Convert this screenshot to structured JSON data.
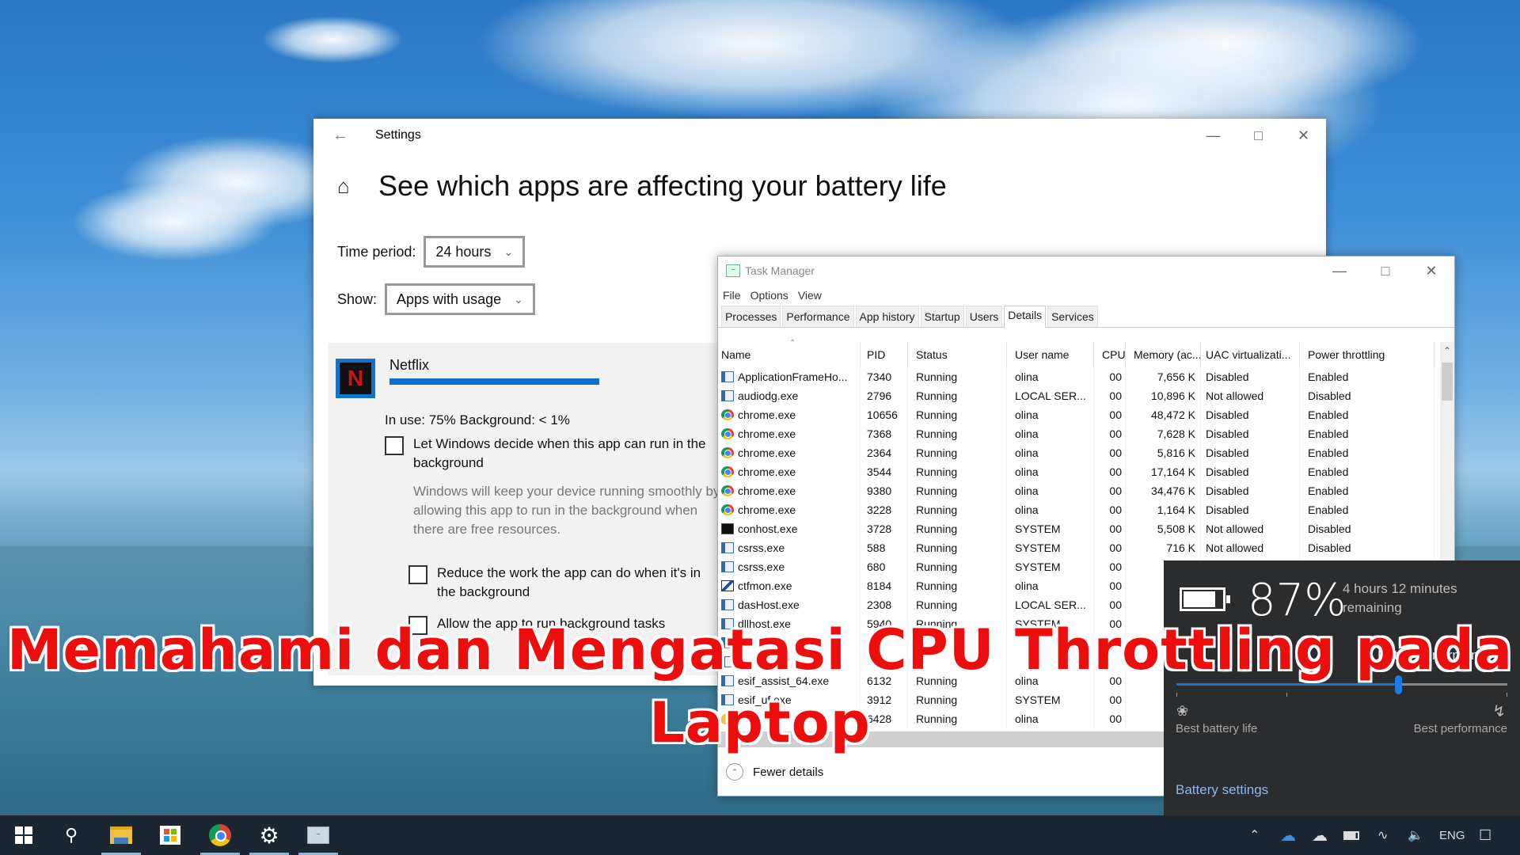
{
  "settings": {
    "window_title": "Settings",
    "heading": "See which apps are affecting your battery life",
    "time_period_label": "Time period:",
    "time_period_value": "24 hours",
    "show_label": "Show:",
    "show_value": "Apps with usage",
    "app": {
      "name": "Netflix",
      "icon_letter": "N",
      "usage_bar_fraction": 0.75,
      "usage_text": "In use: 75% Background: < 1%",
      "option1_label": "Let Windows decide when this app can run in the background",
      "option1_checked": false,
      "option1_desc": "Windows will keep your device running smoothly by allowing this app to run in the background when there are free resources.",
      "option2_label": "Reduce the work the app can do when it's in the background",
      "option2_checked": false,
      "option3_label": "Allow the app to run background tasks",
      "option3_checked": false
    }
  },
  "task_manager": {
    "window_title": "Task Manager",
    "menu": [
      "File",
      "Options",
      "View"
    ],
    "tabs": [
      "Processes",
      "Performance",
      "App history",
      "Startup",
      "Users",
      "Details",
      "Services"
    ],
    "active_tab": "Details",
    "columns": [
      "Name",
      "PID",
      "Status",
      "User name",
      "CPU",
      "Memory (ac...",
      "UAC virtualizati...",
      "Power throttling"
    ],
    "rows": [
      {
        "icon": "win32",
        "name": "ApplicationFrameHo...",
        "pid": "7340",
        "status": "Running",
        "user": "olina",
        "cpu": "00",
        "mem": "7,656 K",
        "uac": "Disabled",
        "pt": "Enabled"
      },
      {
        "icon": "win32",
        "name": "audiodg.exe",
        "pid": "2796",
        "status": "Running",
        "user": "LOCAL SER...",
        "cpu": "00",
        "mem": "10,896 K",
        "uac": "Not allowed",
        "pt": "Disabled"
      },
      {
        "icon": "chrome",
        "name": "chrome.exe",
        "pid": "10656",
        "status": "Running",
        "user": "olina",
        "cpu": "00",
        "mem": "48,472 K",
        "uac": "Disabled",
        "pt": "Enabled"
      },
      {
        "icon": "chrome",
        "name": "chrome.exe",
        "pid": "7368",
        "status": "Running",
        "user": "olina",
        "cpu": "00",
        "mem": "7,628 K",
        "uac": "Disabled",
        "pt": "Enabled"
      },
      {
        "icon": "chrome",
        "name": "chrome.exe",
        "pid": "2364",
        "status": "Running",
        "user": "olina",
        "cpu": "00",
        "mem": "5,816 K",
        "uac": "Disabled",
        "pt": "Enabled"
      },
      {
        "icon": "chrome",
        "name": "chrome.exe",
        "pid": "3544",
        "status": "Running",
        "user": "olina",
        "cpu": "00",
        "mem": "17,164 K",
        "uac": "Disabled",
        "pt": "Enabled"
      },
      {
        "icon": "chrome",
        "name": "chrome.exe",
        "pid": "9380",
        "status": "Running",
        "user": "olina",
        "cpu": "00",
        "mem": "34,476 K",
        "uac": "Disabled",
        "pt": "Enabled"
      },
      {
        "icon": "chrome",
        "name": "chrome.exe",
        "pid": "3228",
        "status": "Running",
        "user": "olina",
        "cpu": "00",
        "mem": "1,164 K",
        "uac": "Disabled",
        "pt": "Enabled"
      },
      {
        "icon": "console",
        "name": "conhost.exe",
        "pid": "3728",
        "status": "Running",
        "user": "SYSTEM",
        "cpu": "00",
        "mem": "5,508 K",
        "uac": "Not allowed",
        "pt": "Disabled"
      },
      {
        "icon": "win32",
        "name": "csrss.exe",
        "pid": "588",
        "status": "Running",
        "user": "SYSTEM",
        "cpu": "00",
        "mem": "716 K",
        "uac": "Not allowed",
        "pt": "Disabled"
      },
      {
        "icon": "win32",
        "name": "csrss.exe",
        "pid": "680",
        "status": "Running",
        "user": "SYSTEM",
        "cpu": "00",
        "mem": "",
        "uac": "",
        "pt": ""
      },
      {
        "icon": "ctf",
        "name": "ctfmon.exe",
        "pid": "8184",
        "status": "Running",
        "user": "olina",
        "cpu": "00",
        "mem": "",
        "uac": "",
        "pt": ""
      },
      {
        "icon": "win32",
        "name": "dasHost.exe",
        "pid": "2308",
        "status": "Running",
        "user": "LOCAL SER...",
        "cpu": "00",
        "mem": "",
        "uac": "",
        "pt": ""
      },
      {
        "icon": "win32",
        "name": "dllhost.exe",
        "pid": "5940",
        "status": "Running",
        "user": "SYSTEM",
        "cpu": "00",
        "mem": "",
        "uac": "",
        "pt": ""
      },
      {
        "icon": "win32",
        "name": "",
        "pid": "",
        "status": "",
        "user": "",
        "cpu": "",
        "mem": "",
        "uac": "",
        "pt": ""
      },
      {
        "icon": "win32",
        "name": "",
        "pid": "",
        "status": "",
        "user": "",
        "cpu": "",
        "mem": "",
        "uac": "",
        "pt": ""
      },
      {
        "icon": "win32",
        "name": "esif_assist_64.exe",
        "pid": "6132",
        "status": "Running",
        "user": "olina",
        "cpu": "00",
        "mem": "",
        "uac": "",
        "pt": ""
      },
      {
        "icon": "win32",
        "name": "esif_uf.exe",
        "pid": "3912",
        "status": "Running",
        "user": "SYSTEM",
        "cpu": "00",
        "mem": "",
        "uac": "",
        "pt": ""
      },
      {
        "icon": "bulb",
        "name": "",
        "pid": "6428",
        "status": "Running",
        "user": "olina",
        "cpu": "00",
        "mem": "",
        "uac": "",
        "pt": ""
      }
    ],
    "fewer_details": "Fewer details"
  },
  "battery": {
    "percent": "87%",
    "remaining": "4 hours 12 minutes remaining",
    "mode_label": "Better performance",
    "slider_fraction": 0.67,
    "left_label": "Best battery life",
    "right_label": "Best performance",
    "settings_link": "Battery settings"
  },
  "taskbar": {
    "apps": [
      "start",
      "search",
      "file-explorer",
      "microsoft-store",
      "chrome",
      "settings",
      "task-manager"
    ],
    "language": "ENG"
  },
  "overlay": {
    "line1": "Memahami dan Mengatasi CPU Throttling pada",
    "line2": "Laptop"
  }
}
